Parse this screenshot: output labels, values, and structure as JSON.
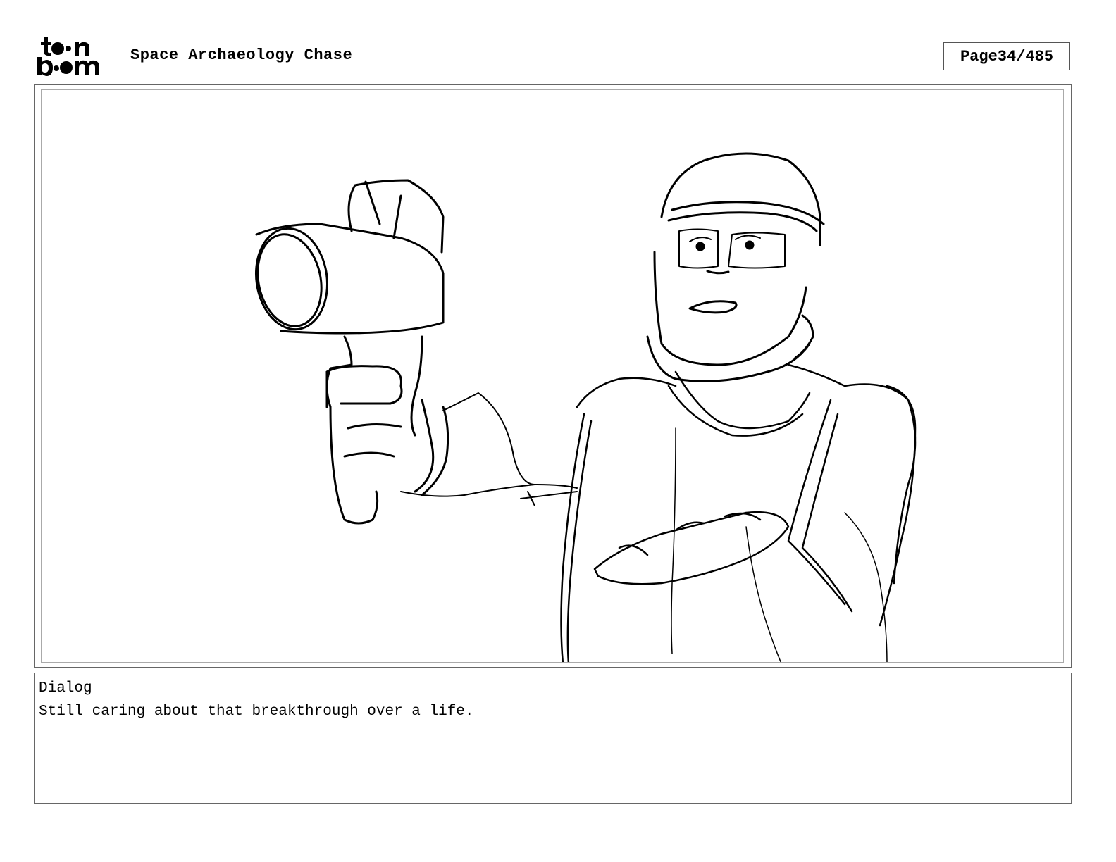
{
  "header": {
    "logo_top": "to•n",
    "logo_bottom": "b••m",
    "project_title": "Space Archaeology Chase",
    "page_label": "Page",
    "page_number": "34/485"
  },
  "panel": {
    "image_description_icon": "storyboard-sketch"
  },
  "dialog": {
    "label": "Dialog",
    "text": "Still caring about that breakthrough over a life."
  }
}
